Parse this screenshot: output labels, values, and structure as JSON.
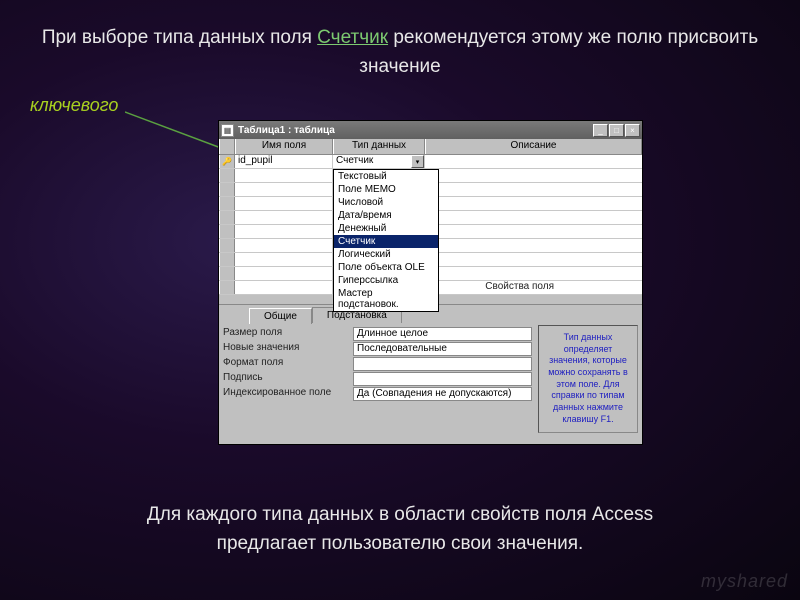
{
  "slide": {
    "top_line1": "При выборе типа данных поля",
    "top_highlight": "Счетчик",
    "top_line2": "рекомендуется этому же полю присвоить значение",
    "key_word": "ключевого",
    "bottom_line1": "Для каждого типа данных в области свойств поля Access",
    "bottom_line2": "предлагает пользователю свои значения.",
    "watermark": "myshared"
  },
  "window": {
    "title": "Таблица1 : таблица",
    "columns": {
      "name": "Имя поля",
      "type": "Тип данных",
      "desc": "Описание"
    },
    "row": {
      "field_name": "id_pupil",
      "type_value": "Счетчик"
    },
    "dropdown": [
      "Текстовый",
      "Поле МЕМО",
      "Числовой",
      "Дата/время",
      "Денежный",
      "Счетчик",
      "Логический",
      "Поле объекта OLE",
      "Гиперссылка",
      "Мастер подстановок."
    ],
    "props_section_label": "Свойства поля",
    "tabs": {
      "general": "Общие",
      "lookup": "Подстановка"
    },
    "props": {
      "size_label": "Размер поля",
      "size_val": "Длинное целое",
      "newvals_label": "Новые значения",
      "newvals_val": "Последовательные",
      "format_label": "Формат поля",
      "format_val": "",
      "caption_label": "Подпись",
      "caption_val": "",
      "indexed_label": "Индексированное поле",
      "indexed_val": "Да (Совпадения не допускаются)"
    },
    "help_text": "Тип данных определяет значения, которые можно сохранять в этом поле. Для справки по типам данных нажмите клавишу F1."
  }
}
